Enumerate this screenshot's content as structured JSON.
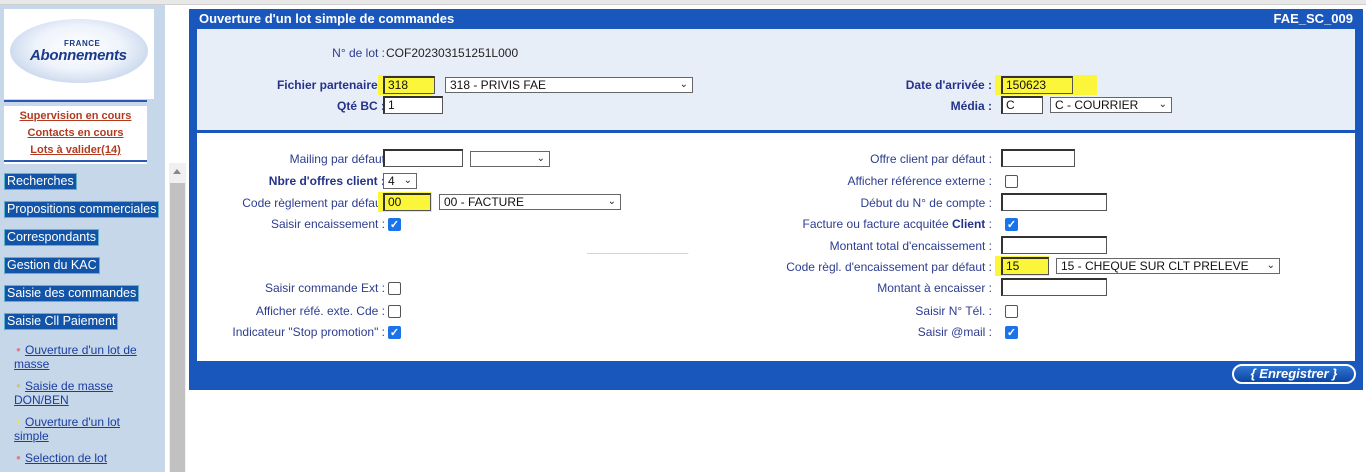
{
  "sidebar": {
    "logo": {
      "top": "FRANCE",
      "name": "Abonnements"
    },
    "alerts": [
      "Supervision en cours",
      "Contacts en cours",
      "Lots à valider(14)"
    ],
    "nav": [
      "Recherches",
      "Propositions commerciales",
      "Correspondants",
      "Gestion du KAC",
      "Saisie des commandes",
      "Saisie Cll Paiement"
    ],
    "sub_items": [
      {
        "line1": "Ouverture d'un lot de",
        "line2": "masse",
        "bullet_color": "#e07a8a"
      },
      {
        "line1": "Saisie de masse",
        "line2": "DON/BEN",
        "bullet_color": "#c4c48a"
      },
      {
        "line1": "Ouverture d'un lot",
        "line2": "simple",
        "bullet_color": "#f0e060"
      },
      {
        "line1": "Selection de lot",
        "line2": "",
        "bullet_color": "#e07a8a"
      }
    ]
  },
  "header": {
    "title": "Ouverture d'un lot simple de commandes",
    "code": "FAE_SC_009"
  },
  "sec1": {
    "lot_label": "N° de lot :",
    "lot_value": "COF202303151251L000",
    "fichier_label": "Fichier partenaire :",
    "fichier_code": "318",
    "fichier_select": "318 - PRIVIS FAE",
    "qte_label": "Qté BC :",
    "qte_value": "1",
    "date_label": "Date d'arrivée :",
    "date_value": "150623",
    "media_label": "Média :",
    "media_code": "C",
    "media_select": "C - COURRIER"
  },
  "sec2": {
    "mailing_label": "Mailing par défaut",
    "mailing_value": "",
    "mailing_select": "",
    "nbre_label": "Nbre d'offres client :",
    "nbre_select": "4",
    "code_regl_label": "Code règlement par défaut",
    "code_regl_value": "00",
    "code_regl_select": "00 - FACTURE",
    "saisir_enc_label": "Saisir encaissement :",
    "saisir_cmd_ext_label": "Saisir commande Ext :",
    "afficher_refe_label": "Afficher réfé. exte. Cde :",
    "stop_promo_label": "Indicateur \"Stop promotion\" :",
    "offre_label": "Offre client par défaut :",
    "afficher_ref_ext_label": "Afficher référence externe :",
    "debut_compte_label": "Début du N° de compte :",
    "facture_label": "Facture ou facture acquitée",
    "facture_label_bold": "Client",
    "facture_label_end": ":",
    "montant_total_label": "Montant total d'encaissement :",
    "code_regl_enc_label": "Code règl. d'encaissement par défaut :",
    "code_regl_enc_value": "15",
    "code_regl_enc_select": "15 - CHEQUE SUR CLT PRELEVE",
    "montant_enc_label": "Montant à encaisser :",
    "saisir_tel_label": "Saisir N° Tél. :",
    "saisir_mail_label": "Saisir @mail :"
  },
  "checkboxes": {
    "saisir_encaissement": true,
    "saisir_cmd_ext": false,
    "afficher_refe": false,
    "stop_promo": true,
    "afficher_ref_ext": false,
    "facture_client": true,
    "saisir_tel": false,
    "saisir_mail": true
  },
  "save_label": "{ Enregistrer }",
  "colors": {
    "header_blue": "#1a57bd",
    "highlight": "#fbf63a",
    "nav_blue": "#1255a8",
    "alert_red": "#b23a1f"
  }
}
